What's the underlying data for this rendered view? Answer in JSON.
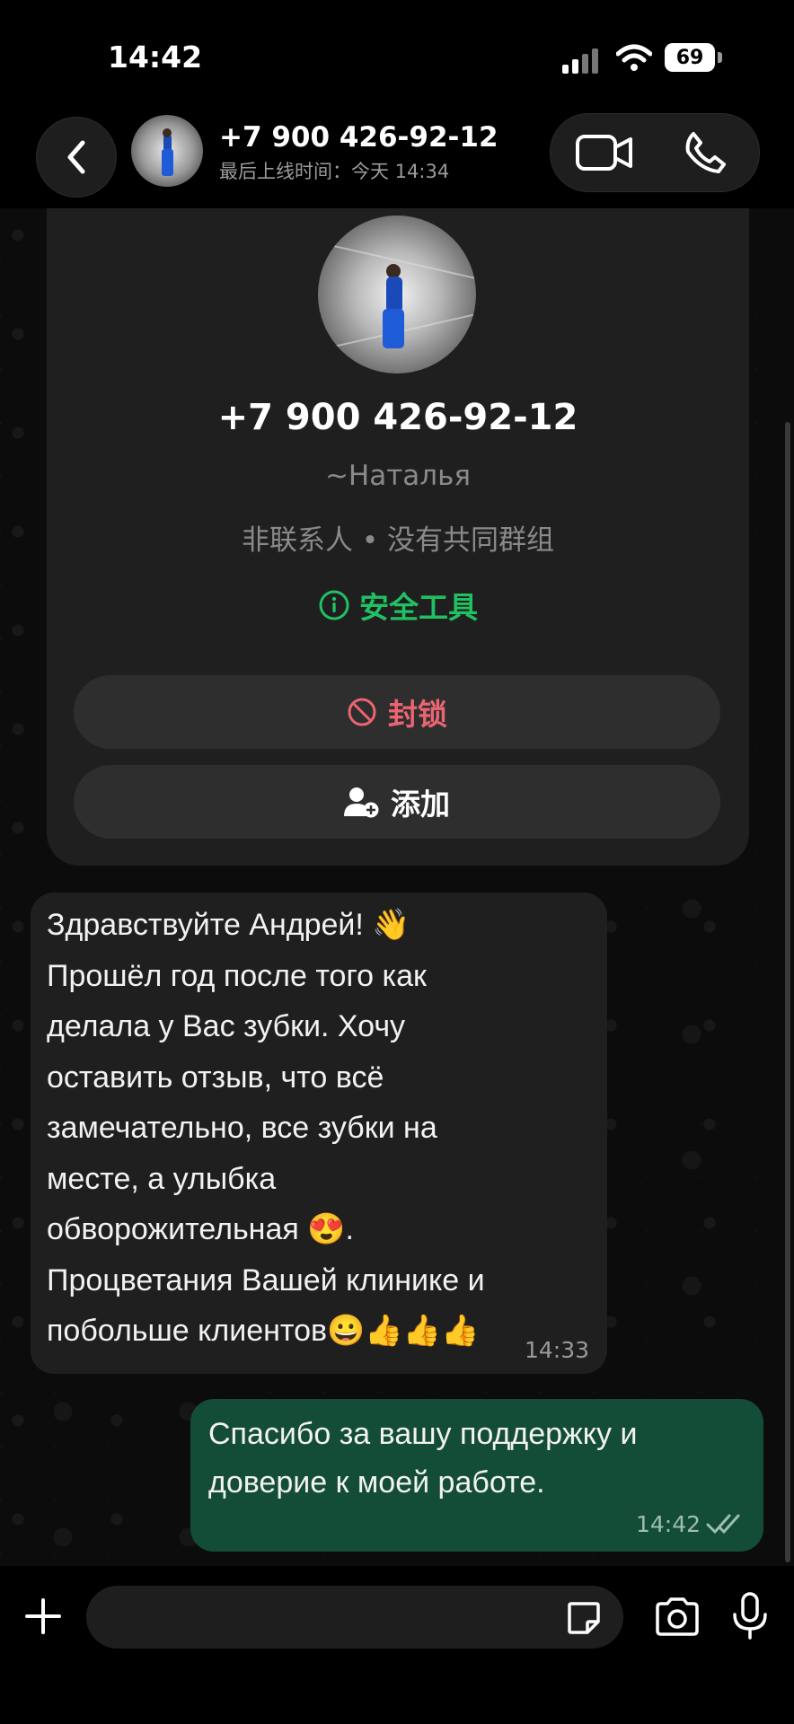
{
  "status_bar": {
    "time": "14:42",
    "battery": "69"
  },
  "header": {
    "back_icon": "chevron-left-icon",
    "contact_name": "+7 900 426-92-12",
    "last_seen": "最后上线时间：今天 14:34",
    "video_icon": "video-camera-icon",
    "call_icon": "phone-icon"
  },
  "profile_card": {
    "phone": "+7 900 426-92-12",
    "alias": "~Наталья",
    "info": "非联系人 • 没有共同群组",
    "safety_label": "安全工具",
    "block_label": "封锁",
    "add_label": "添加"
  },
  "messages": [
    {
      "direction": "incoming",
      "text": "Здравствуйте Андрей! 👋\nПрошёл год  после того как\nделала у Вас зубки. Хочу\nоставить отзыв, что всё\nзамечательно, все зубки на\nместе, а улыбка\nобворожительная 😍.\nПроцветания Вашей клинике и\nпобольше клиентов😀👍👍👍",
      "time": "14:33"
    },
    {
      "direction": "outgoing",
      "text": "Спасибо за вашу поддержку и\nдоверие к моей работе.",
      "time": "14:42",
      "status_icon": "double-check-icon"
    }
  ],
  "input_bar": {
    "placeholder": "",
    "attach_icon": "plus-icon",
    "sticker_icon": "sticker-icon",
    "camera_icon": "camera-icon",
    "mic_icon": "microphone-icon"
  },
  "colors": {
    "accent_green": "#21c063",
    "block_red": "#ea6571",
    "outgoing_bubble": "#144d37",
    "incoming_bubble": "#1f1f1f"
  }
}
